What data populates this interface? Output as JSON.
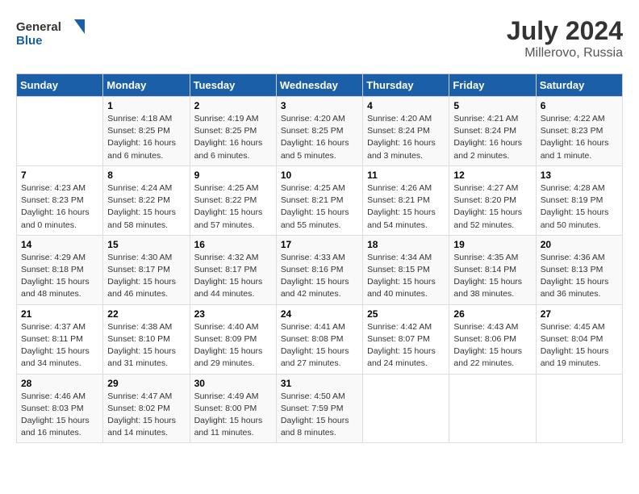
{
  "header": {
    "logo_general": "General",
    "logo_blue": "Blue",
    "month_year": "July 2024",
    "location": "Millerovo, Russia"
  },
  "days_of_week": [
    "Sunday",
    "Monday",
    "Tuesday",
    "Wednesday",
    "Thursday",
    "Friday",
    "Saturday"
  ],
  "weeks": [
    [
      {
        "day": "",
        "info": ""
      },
      {
        "day": "1",
        "info": "Sunrise: 4:18 AM\nSunset: 8:25 PM\nDaylight: 16 hours\nand 6 minutes."
      },
      {
        "day": "2",
        "info": "Sunrise: 4:19 AM\nSunset: 8:25 PM\nDaylight: 16 hours\nand 6 minutes."
      },
      {
        "day": "3",
        "info": "Sunrise: 4:20 AM\nSunset: 8:25 PM\nDaylight: 16 hours\nand 5 minutes."
      },
      {
        "day": "4",
        "info": "Sunrise: 4:20 AM\nSunset: 8:24 PM\nDaylight: 16 hours\nand 3 minutes."
      },
      {
        "day": "5",
        "info": "Sunrise: 4:21 AM\nSunset: 8:24 PM\nDaylight: 16 hours\nand 2 minutes."
      },
      {
        "day": "6",
        "info": "Sunrise: 4:22 AM\nSunset: 8:23 PM\nDaylight: 16 hours\nand 1 minute."
      }
    ],
    [
      {
        "day": "7",
        "info": "Sunrise: 4:23 AM\nSunset: 8:23 PM\nDaylight: 16 hours\nand 0 minutes."
      },
      {
        "day": "8",
        "info": "Sunrise: 4:24 AM\nSunset: 8:22 PM\nDaylight: 15 hours\nand 58 minutes."
      },
      {
        "day": "9",
        "info": "Sunrise: 4:25 AM\nSunset: 8:22 PM\nDaylight: 15 hours\nand 57 minutes."
      },
      {
        "day": "10",
        "info": "Sunrise: 4:25 AM\nSunset: 8:21 PM\nDaylight: 15 hours\nand 55 minutes."
      },
      {
        "day": "11",
        "info": "Sunrise: 4:26 AM\nSunset: 8:21 PM\nDaylight: 15 hours\nand 54 minutes."
      },
      {
        "day": "12",
        "info": "Sunrise: 4:27 AM\nSunset: 8:20 PM\nDaylight: 15 hours\nand 52 minutes."
      },
      {
        "day": "13",
        "info": "Sunrise: 4:28 AM\nSunset: 8:19 PM\nDaylight: 15 hours\nand 50 minutes."
      }
    ],
    [
      {
        "day": "14",
        "info": "Sunrise: 4:29 AM\nSunset: 8:18 PM\nDaylight: 15 hours\nand 48 minutes."
      },
      {
        "day": "15",
        "info": "Sunrise: 4:30 AM\nSunset: 8:17 PM\nDaylight: 15 hours\nand 46 minutes."
      },
      {
        "day": "16",
        "info": "Sunrise: 4:32 AM\nSunset: 8:17 PM\nDaylight: 15 hours\nand 44 minutes."
      },
      {
        "day": "17",
        "info": "Sunrise: 4:33 AM\nSunset: 8:16 PM\nDaylight: 15 hours\nand 42 minutes."
      },
      {
        "day": "18",
        "info": "Sunrise: 4:34 AM\nSunset: 8:15 PM\nDaylight: 15 hours\nand 40 minutes."
      },
      {
        "day": "19",
        "info": "Sunrise: 4:35 AM\nSunset: 8:14 PM\nDaylight: 15 hours\nand 38 minutes."
      },
      {
        "day": "20",
        "info": "Sunrise: 4:36 AM\nSunset: 8:13 PM\nDaylight: 15 hours\nand 36 minutes."
      }
    ],
    [
      {
        "day": "21",
        "info": "Sunrise: 4:37 AM\nSunset: 8:11 PM\nDaylight: 15 hours\nand 34 minutes."
      },
      {
        "day": "22",
        "info": "Sunrise: 4:38 AM\nSunset: 8:10 PM\nDaylight: 15 hours\nand 31 minutes."
      },
      {
        "day": "23",
        "info": "Sunrise: 4:40 AM\nSunset: 8:09 PM\nDaylight: 15 hours\nand 29 minutes."
      },
      {
        "day": "24",
        "info": "Sunrise: 4:41 AM\nSunset: 8:08 PM\nDaylight: 15 hours\nand 27 minutes."
      },
      {
        "day": "25",
        "info": "Sunrise: 4:42 AM\nSunset: 8:07 PM\nDaylight: 15 hours\nand 24 minutes."
      },
      {
        "day": "26",
        "info": "Sunrise: 4:43 AM\nSunset: 8:06 PM\nDaylight: 15 hours\nand 22 minutes."
      },
      {
        "day": "27",
        "info": "Sunrise: 4:45 AM\nSunset: 8:04 PM\nDaylight: 15 hours\nand 19 minutes."
      }
    ],
    [
      {
        "day": "28",
        "info": "Sunrise: 4:46 AM\nSunset: 8:03 PM\nDaylight: 15 hours\nand 16 minutes."
      },
      {
        "day": "29",
        "info": "Sunrise: 4:47 AM\nSunset: 8:02 PM\nDaylight: 15 hours\nand 14 minutes."
      },
      {
        "day": "30",
        "info": "Sunrise: 4:49 AM\nSunset: 8:00 PM\nDaylight: 15 hours\nand 11 minutes."
      },
      {
        "day": "31",
        "info": "Sunrise: 4:50 AM\nSunset: 7:59 PM\nDaylight: 15 hours\nand 8 minutes."
      },
      {
        "day": "",
        "info": ""
      },
      {
        "day": "",
        "info": ""
      },
      {
        "day": "",
        "info": ""
      }
    ]
  ]
}
